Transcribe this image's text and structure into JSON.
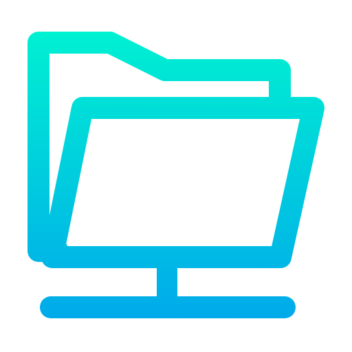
{
  "icon": {
    "name": "network-folder-icon",
    "style": "outline",
    "gradient": {
      "top_color": "#00F0D2",
      "bottom_color": "#00AAEA"
    },
    "background": "#FFFFFF"
  }
}
